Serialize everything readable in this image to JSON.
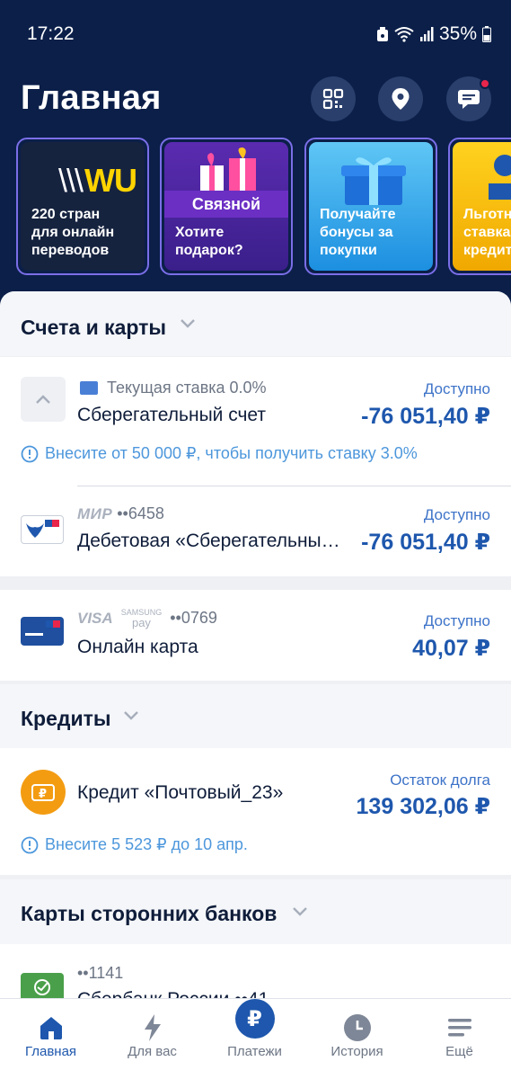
{
  "status": {
    "time": "17:22",
    "battery": "35%"
  },
  "header": {
    "title": "Главная"
  },
  "stories": [
    {
      "text_line1": "220 стран",
      "text_line2": "для онлайн",
      "text_line3": "переводов",
      "logo": "WU"
    },
    {
      "text_line1": "Хотите",
      "text_line2": "подарок?",
      "logo": "Связной"
    },
    {
      "text_line1": "Получайте",
      "text_line2": "бонусы за",
      "text_line3": "покупки"
    },
    {
      "text_line1": "Льготн",
      "text_line2": "ставка",
      "text_line3": "кредит"
    }
  ],
  "accounts": {
    "title": "Счета и карты",
    "savings": {
      "rate": "Текущая ставка 0.0%",
      "name": "Сберегательный счет",
      "avail_label": "Доступно",
      "amount": "-76 051,40 ₽",
      "notice": "Внесите от 50 000 ₽, чтобы получить ставку 3.0%"
    },
    "debit": {
      "brand": "МИР",
      "number": "••6458",
      "name": "Дебетовая «Сберегательны…",
      "avail_label": "Доступно",
      "amount": "-76 051,40 ₽"
    },
    "online": {
      "brand": "VISA",
      "brand2_line1": "SAMSUNG",
      "brand2_line2": "pay",
      "number": "••0769",
      "name": "Онлайн карта",
      "avail_label": "Доступно",
      "amount": "40,07 ₽"
    }
  },
  "credits": {
    "title": "Кредиты",
    "item": {
      "name": "Кредит «Почтовый_23»",
      "label": "Остаток долга",
      "amount": "139 302,06 ₽",
      "notice": "Внесите 5 523 ₽ до 10 апр."
    }
  },
  "third_party": {
    "title": "Карты сторонних банков",
    "item": {
      "number": "••1141",
      "name": "Сбербанк России ••41"
    }
  },
  "nav": [
    {
      "label": "Главная"
    },
    {
      "label": "Для вас"
    },
    {
      "label": "Платежи"
    },
    {
      "label": "История"
    },
    {
      "label": "Ещё"
    }
  ],
  "colors": {
    "header_bg": "#0b1f49",
    "accent": "#1e57ad",
    "notice": "#4d97dc",
    "badge": "#e8254b"
  }
}
